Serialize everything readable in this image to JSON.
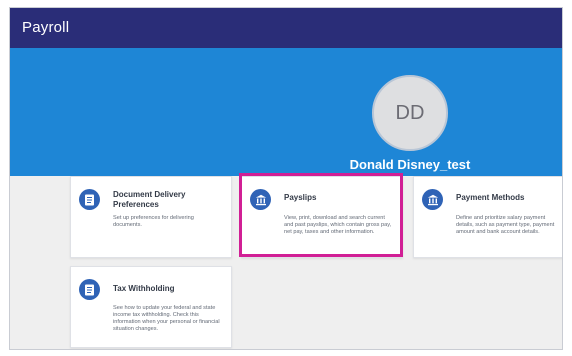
{
  "header": {
    "title": "Payroll"
  },
  "profile": {
    "initials": "DD",
    "name": "Donald Disney_test"
  },
  "cards": [
    {
      "title": "Document Delivery Preferences",
      "description": "Set up preferences for delivering documents.",
      "icon": "document-icon"
    },
    {
      "title": "Payslips",
      "description": "View, print, download and search current and past payslips, which contain gross pay, net pay, taxes and other information.",
      "icon": "bank-icon"
    },
    {
      "title": "Payment Methods",
      "description": "Define and prioritize salary payment details, such as payment type, payment amount and bank account details.",
      "icon": "bank-icon"
    },
    {
      "title": "Tax Withholding",
      "description": "See how to update your federal and state income tax withholding. Check this information when your personal or financial situation changes.",
      "icon": "document-icon"
    }
  ],
  "colors": {
    "topbar": "#2a2d78",
    "hero": "#1e86d6",
    "icon": "#2f63b6",
    "highlight": "#d11f95"
  }
}
